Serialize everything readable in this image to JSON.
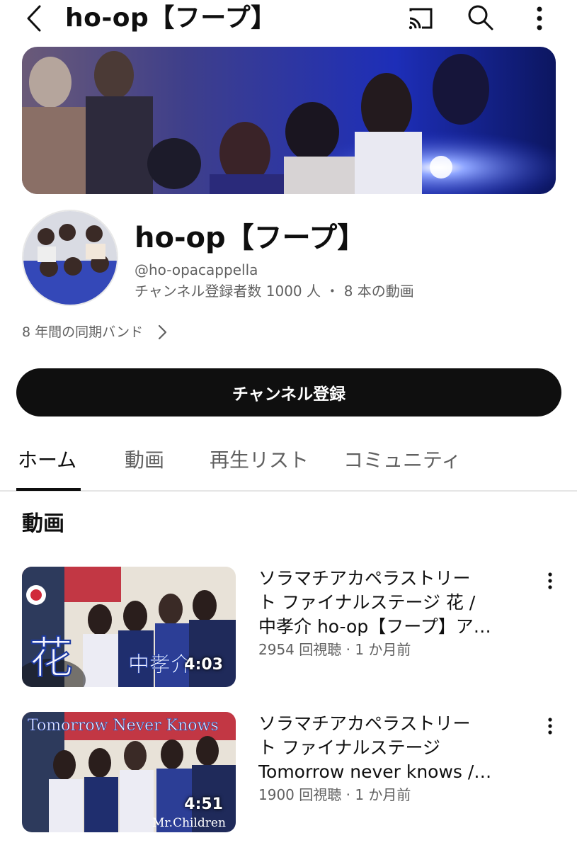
{
  "topbar": {
    "title": "ho-op【フープ】",
    "icons": [
      "back-arrow-icon",
      "cast-icon",
      "search-icon",
      "more-vertical-icon"
    ]
  },
  "channel": {
    "name": "ho-op【フープ】",
    "handle": "@ho-opacappella",
    "stats": "チャンネル登録者数 1000 人 ・ 8 本の動画",
    "description": "8 年間の同期バンド",
    "subscribe_label": "チャンネル登録"
  },
  "tabs": [
    {
      "label": "ホーム",
      "active": true
    },
    {
      "label": "動画",
      "active": false
    },
    {
      "label": "再生リスト",
      "active": false
    },
    {
      "label": "コミュニティ",
      "active": false
    }
  ],
  "section": {
    "heading": "動画"
  },
  "videos": [
    {
      "title_lines": [
        "ソラマチアカペラストリー",
        "ト ファイナルステージ  花 /",
        "中孝介 ho-op【フープ】ア…"
      ],
      "meta": "2954 回視聴 · 1 か月前",
      "duration": "4:03",
      "thumb_text": [
        "花",
        "中孝介"
      ]
    },
    {
      "title_lines": [
        "ソラマチアカペラストリー",
        "ト ファイナルステージ",
        "Tomorrow never knows /…"
      ],
      "meta": "1900 回視聴 · 1 か月前",
      "duration": "4:51",
      "thumb_text": [
        "Tomorrow Never Knows",
        "Mr.Children"
      ]
    }
  ],
  "colors": {
    "text_primary": "#0f0f0f",
    "text_secondary": "#606060",
    "subscribe_bg": "#0f0f0f",
    "banner_blue": "#2a3fd0"
  }
}
